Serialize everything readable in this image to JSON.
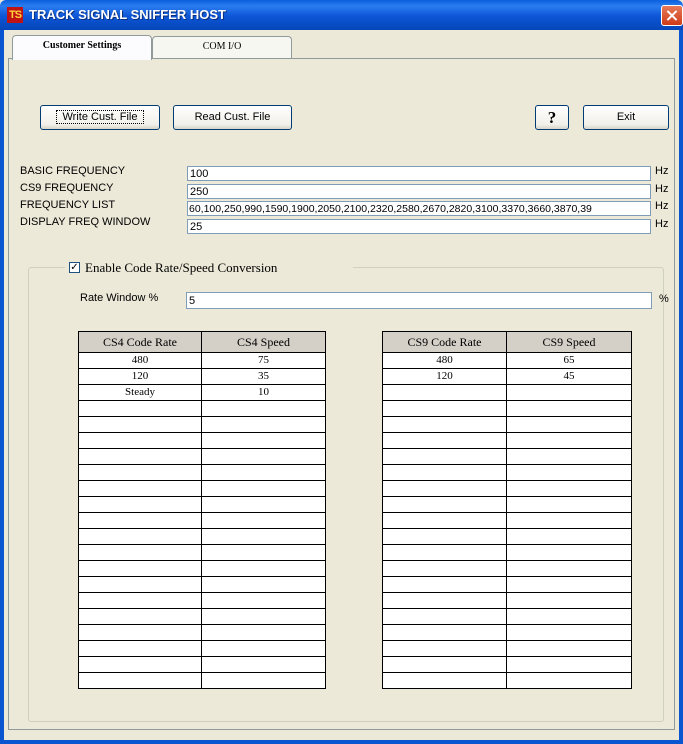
{
  "window": {
    "title": "TRACK SIGNAL SNIFFER HOST",
    "icon_text": "TS"
  },
  "tabs": [
    {
      "label": "Customer Settings",
      "active": true
    },
    {
      "label": "COM I/O",
      "active": false
    }
  ],
  "toolbar": {
    "write_label": "Write Cust. File",
    "read_label": "Read Cust. File",
    "help_label": "?",
    "exit_label": "Exit"
  },
  "settings": {
    "basic_frequency": {
      "label": "BASIC FREQUENCY",
      "value": "100",
      "unit": "Hz"
    },
    "cs9_frequency": {
      "label": "CS9 FREQUENCY",
      "value": "250",
      "unit": "Hz"
    },
    "frequency_list": {
      "label": "FREQUENCY LIST",
      "value": "60,100,250,990,1590,1900,2050,2100,2320,2580,2670,2820,3100,3370,3660,3870,39",
      "unit": "Hz"
    },
    "display_freq_window": {
      "label": "DISPLAY FREQ WINDOW",
      "value": "25",
      "unit": "Hz"
    }
  },
  "conversion": {
    "enable_label": "Enable Code Rate/Speed Conversion",
    "enabled": true,
    "rate_window_label": "Rate Window %",
    "rate_window_value": "5",
    "rate_window_unit": "%"
  },
  "cs4_table": {
    "headers": [
      "CS4 Code Rate",
      "CS4 Speed"
    ],
    "rows": [
      [
        "480",
        "75"
      ],
      [
        "120",
        "35"
      ],
      [
        "Steady",
        "10"
      ],
      [
        "",
        ""
      ],
      [
        "",
        ""
      ],
      [
        "",
        ""
      ],
      [
        "",
        ""
      ],
      [
        "",
        ""
      ],
      [
        "",
        ""
      ],
      [
        "",
        ""
      ],
      [
        "",
        ""
      ],
      [
        "",
        ""
      ],
      [
        "",
        ""
      ],
      [
        "",
        ""
      ],
      [
        "",
        ""
      ],
      [
        "",
        ""
      ],
      [
        "",
        ""
      ],
      [
        "",
        ""
      ],
      [
        "",
        ""
      ],
      [
        "",
        ""
      ],
      [
        "",
        ""
      ]
    ]
  },
  "cs9_table": {
    "headers": [
      "CS9 Code Rate",
      "CS9 Speed"
    ],
    "rows": [
      [
        "480",
        "65"
      ],
      [
        "120",
        "45"
      ],
      [
        "",
        ""
      ],
      [
        "",
        ""
      ],
      [
        "",
        ""
      ],
      [
        "",
        ""
      ],
      [
        "",
        ""
      ],
      [
        "",
        ""
      ],
      [
        "",
        ""
      ],
      [
        "",
        ""
      ],
      [
        "",
        ""
      ],
      [
        "",
        ""
      ],
      [
        "",
        ""
      ],
      [
        "",
        ""
      ],
      [
        "",
        ""
      ],
      [
        "",
        ""
      ],
      [
        "",
        ""
      ],
      [
        "",
        ""
      ],
      [
        "",
        ""
      ],
      [
        "",
        ""
      ],
      [
        "",
        ""
      ]
    ]
  }
}
